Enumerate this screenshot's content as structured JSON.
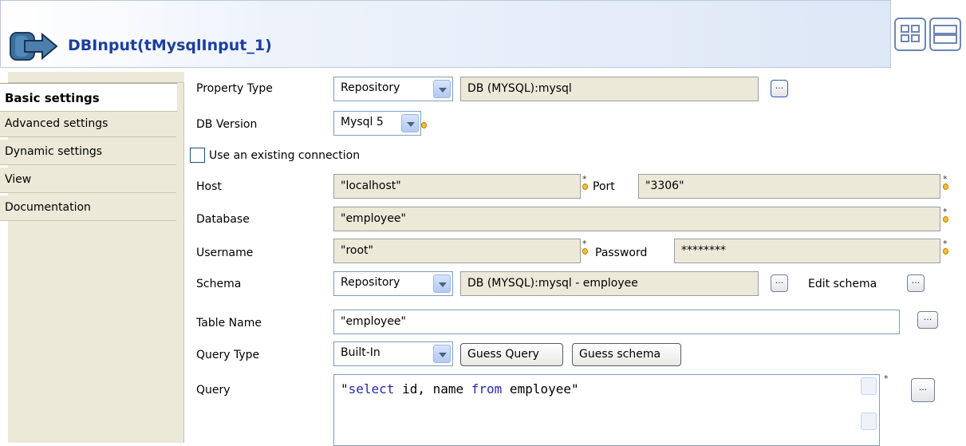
{
  "header": {
    "title": "DBInput(tMysqlInput_1)"
  },
  "tabs": [
    {
      "label": "Basic settings"
    },
    {
      "label": "Advanced settings"
    },
    {
      "label": "Dynamic settings"
    },
    {
      "label": "View"
    },
    {
      "label": "Documentation"
    }
  ],
  "form": {
    "property_type": {
      "label": "Property Type",
      "value": "Repository",
      "repo": "DB (MYSQL):mysql"
    },
    "db_version": {
      "label": "DB Version",
      "value": "Mysql 5"
    },
    "use_existing": {
      "label": "Use an existing connection",
      "checked": false
    },
    "host": {
      "label": "Host",
      "value": "\"localhost\""
    },
    "port": {
      "label": "Port",
      "value": "\"3306\""
    },
    "database": {
      "label": "Database",
      "value": "\"employee\""
    },
    "username": {
      "label": "Username",
      "value": "\"root\""
    },
    "password": {
      "label": "Password",
      "value": "********"
    },
    "schema": {
      "label": "Schema",
      "value": "Repository",
      "repo": "DB (MYSQL):mysql - employee",
      "edit_label": "Edit schema"
    },
    "table_name": {
      "label": "Table Name",
      "value": "\"employee\""
    },
    "query_type": {
      "label": "Query Type",
      "value": "Built-In",
      "guess_query": "Guess Query",
      "guess_schema": "Guess schema"
    },
    "query": {
      "label": "Query",
      "q_open": "\"",
      "kw1": "select",
      "mid": " id, name ",
      "kw2": "from",
      "tail": " employee\""
    }
  },
  "dots_label": "...",
  "required_mark": "*"
}
